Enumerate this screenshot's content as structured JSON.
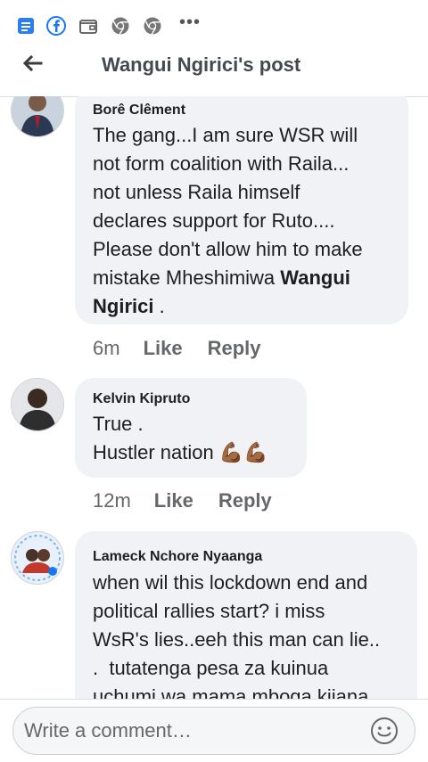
{
  "statusbar": {
    "icons": [
      "notes-icon",
      "facebook-icon",
      "wallet-icon",
      "chrome-icon",
      "chrome-icon"
    ],
    "overflow": "•••"
  },
  "header": {
    "title": "Wangui Ngirici's post",
    "back_icon": "back-arrow-icon"
  },
  "comments": [
    {
      "author": "Borê Clêment",
      "lines": [
        "The gang...I am sure WSR will",
        "not form coalition with Raila...",
        "not unless Raila himself",
        "declares support for Ruto....",
        "Please don't allow him to make",
        "mistake Mheshimiwa "
      ],
      "mention_1": "Wangui",
      "mention_2": "Ngirici",
      "after_mention": " .",
      "time": "6m",
      "like": "Like",
      "reply": "Reply"
    },
    {
      "author": "Kelvin Kipruto",
      "line1": "True .",
      "line2": "Hustler nation ",
      "emoji": "💪🏾💪🏾",
      "time": "12m",
      "like": "Like",
      "reply": "Reply"
    },
    {
      "author": "Lameck Nchore Nyaanga",
      "lines": [
        "when wil this lockdown end and",
        "political rallies start? i miss",
        "WsR's lies..eeh this man can lie..",
        ".  tutatenga pesa za kuinua",
        "uchumi wa mama mboga,kijana"
      ]
    }
  ],
  "composer": {
    "placeholder": "Write a comment…",
    "emoji_icon": "smiley-icon"
  },
  "colors": {
    "bubble": "#f0f2f5",
    "facebook_blue": "#1877f2",
    "muted": "#65676b"
  }
}
